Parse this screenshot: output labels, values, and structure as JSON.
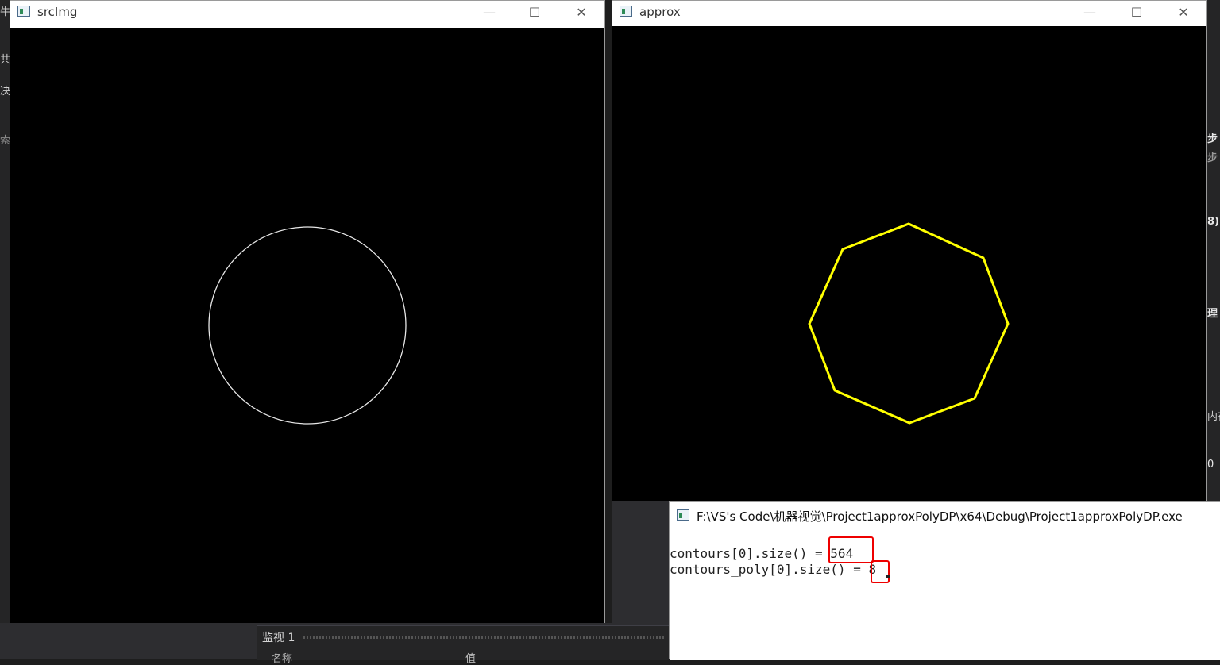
{
  "src_window": {
    "title": "srcImg",
    "shape_color": "#e8e8e8"
  },
  "approx_window": {
    "title": "approx",
    "shape_color": "#ffff00"
  },
  "console": {
    "title": "F:\\VS's Code\\机器视觉\\Project1approxPolyDP\\x64\\Debug\\Project1approxPolyDP.exe",
    "line1_prefix": "contours[0].size() = ",
    "line1_value": "564",
    "line2_prefix": "contours_poly[0].size() = ",
    "line2_value": "8",
    "highlight_color": "#ee0000"
  },
  "window_controls": {
    "minimize": "—",
    "maximize": "☐",
    "close": "✕"
  },
  "ide": {
    "watch_title": "监视 1",
    "col_name": "名称",
    "col_value": "值",
    "left_fragments": [
      "牛",
      "共",
      "决",
      "索"
    ],
    "right_fragments": [
      "步",
      "步",
      "8)",
      "理",
      "内存",
      "0"
    ]
  }
}
